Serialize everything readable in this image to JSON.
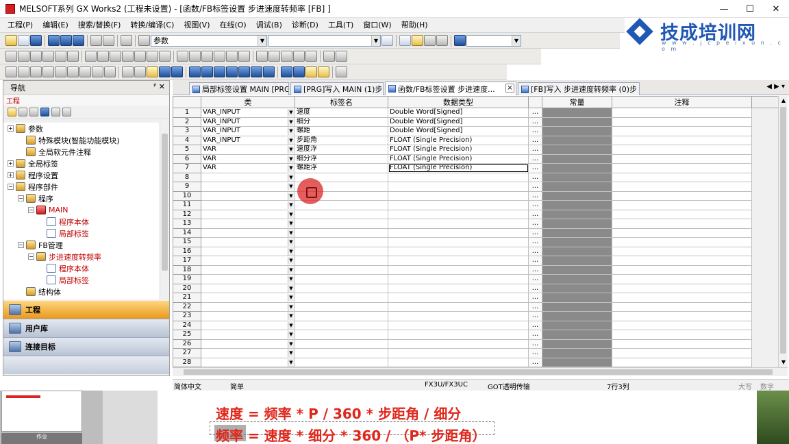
{
  "window": {
    "title": "MELSOFT系列 GX Works2 (工程未设置) - [函数/FB标签设置 步进速度转频率 [FB] ]",
    "controls": [
      "—",
      "☐",
      "✕"
    ]
  },
  "menu": [
    "工程(P)",
    "编辑(E)",
    "搜索/替换(F)",
    "转换/编译(C)",
    "视图(V)",
    "在线(O)",
    "调试(B)",
    "诊断(D)",
    "工具(T)",
    "窗口(W)",
    "帮助(H)"
  ],
  "toolbar": {
    "combo_value": "参数"
  },
  "logo": {
    "text": "技成培训网",
    "url": "w w w . j c p e i x u n . c o m",
    "brand_color": "#1f58b4"
  },
  "nav": {
    "header": "导航",
    "header_controls": "ᴾ ✕",
    "section": "工程",
    "tree": [
      {
        "label": "参数",
        "level": 0,
        "exp": "+",
        "icon": "folder",
        "red": false
      },
      {
        "label": "特殊模块(智能功能模块)",
        "level": 1,
        "exp": "",
        "icon": "folder",
        "red": false
      },
      {
        "label": "全局软元件注释",
        "level": 1,
        "exp": "",
        "icon": "folder",
        "red": false
      },
      {
        "label": "全局标签",
        "level": 0,
        "exp": "+",
        "icon": "folder",
        "red": false
      },
      {
        "label": "程序设置",
        "level": 0,
        "exp": "+",
        "icon": "folder",
        "red": false
      },
      {
        "label": "程序部件",
        "level": 0,
        "exp": "−",
        "icon": "folder",
        "red": false
      },
      {
        "label": "程序",
        "level": 1,
        "exp": "−",
        "icon": "folder",
        "red": false
      },
      {
        "label": "MAIN",
        "level": 2,
        "exp": "−",
        "icon": "red",
        "red": true
      },
      {
        "label": "程序本体",
        "level": 3,
        "exp": "",
        "icon": "doc",
        "red": true
      },
      {
        "label": "局部标签",
        "level": 3,
        "exp": "",
        "icon": "doc",
        "red": true
      },
      {
        "label": "FB管理",
        "level": 1,
        "exp": "−",
        "icon": "folder",
        "red": false
      },
      {
        "label": "步进速度转频率",
        "level": 2,
        "exp": "−",
        "icon": "folder",
        "red": true
      },
      {
        "label": "程序本体",
        "level": 3,
        "exp": "",
        "icon": "doc",
        "red": true
      },
      {
        "label": "局部标签",
        "level": 3,
        "exp": "",
        "icon": "doc",
        "red": true
      },
      {
        "label": "结构体",
        "level": 1,
        "exp": "",
        "icon": "folder",
        "red": false
      }
    ],
    "buttons": [
      "工程",
      "用户库",
      "连接目标"
    ]
  },
  "tabs": [
    {
      "label": "局部标签设置 MAIN [PRG]",
      "active": false
    },
    {
      "label": "[PRG]写入 MAIN (1)步",
      "active": false
    },
    {
      "label": "函数/FB标签设置 步进速度...",
      "active": true
    },
    {
      "label": "[FB]写入 步进速度转频率 (0)步 *",
      "active": false
    }
  ],
  "tab_nav": "◀ ▶ ▾",
  "grid": {
    "headers": [
      "",
      "类",
      "标签名",
      "数据类型",
      "",
      "常量",
      "注释"
    ],
    "rows": [
      {
        "n": "1",
        "cls": "VAR_INPUT",
        "name": "速度",
        "type": "Double Word[Signed]"
      },
      {
        "n": "2",
        "cls": "VAR_INPUT",
        "name": "细分",
        "type": "Double Word[Signed]"
      },
      {
        "n": "3",
        "cls": "VAR_INPUT",
        "name": "螺距",
        "type": "Double Word[Signed]"
      },
      {
        "n": "4",
        "cls": "VAR_INPUT",
        "name": "步距角",
        "type": "FLOAT (Single Precision)"
      },
      {
        "n": "5",
        "cls": "VAR",
        "name": "速度浮",
        "type": "FLOAT (Single Precision)"
      },
      {
        "n": "6",
        "cls": "VAR",
        "name": "细分浮",
        "type": "FLOAT (Single Precision)"
      },
      {
        "n": "7",
        "cls": "VAR",
        "name": "螺距浮",
        "type": "FLOAT (Single Precision)"
      },
      {
        "n": "8",
        "cls": "",
        "name": "",
        "type": ""
      },
      {
        "n": "9",
        "cls": "",
        "name": "",
        "type": ""
      },
      {
        "n": "10",
        "cls": "",
        "name": "",
        "type": ""
      },
      {
        "n": "11",
        "cls": "",
        "name": "",
        "type": ""
      },
      {
        "n": "12",
        "cls": "",
        "name": "",
        "type": ""
      },
      {
        "n": "13",
        "cls": "",
        "name": "",
        "type": ""
      },
      {
        "n": "14",
        "cls": "",
        "name": "",
        "type": ""
      },
      {
        "n": "15",
        "cls": "",
        "name": "",
        "type": ""
      },
      {
        "n": "16",
        "cls": "",
        "name": "",
        "type": ""
      },
      {
        "n": "17",
        "cls": "",
        "name": "",
        "type": ""
      },
      {
        "n": "18",
        "cls": "",
        "name": "",
        "type": ""
      },
      {
        "n": "19",
        "cls": "",
        "name": "",
        "type": ""
      },
      {
        "n": "20",
        "cls": "",
        "name": "",
        "type": ""
      },
      {
        "n": "21",
        "cls": "",
        "name": "",
        "type": ""
      },
      {
        "n": "22",
        "cls": "",
        "name": "",
        "type": ""
      },
      {
        "n": "23",
        "cls": "",
        "name": "",
        "type": ""
      },
      {
        "n": "24",
        "cls": "",
        "name": "",
        "type": ""
      },
      {
        "n": "25",
        "cls": "",
        "name": "",
        "type": ""
      },
      {
        "n": "26",
        "cls": "",
        "name": "",
        "type": ""
      },
      {
        "n": "27",
        "cls": "",
        "name": "",
        "type": ""
      },
      {
        "n": "28",
        "cls": "",
        "name": "",
        "type": ""
      }
    ],
    "button_glyph": "..."
  },
  "status": {
    "lang": "简体中文",
    "mode": "简单",
    "plc": "FX3U/FX3UC",
    "conn": "GOT透明传输",
    "pos": "7行3列",
    "caps": "大写",
    "num": "数字"
  },
  "overlay": {
    "formula1": "速度 = 频率 * P / 360 * 步距角 / 细分",
    "formula2": "频率 = 速度 * 细分 * 360 / （P* 步距角）",
    "thumb_label": "作业"
  }
}
